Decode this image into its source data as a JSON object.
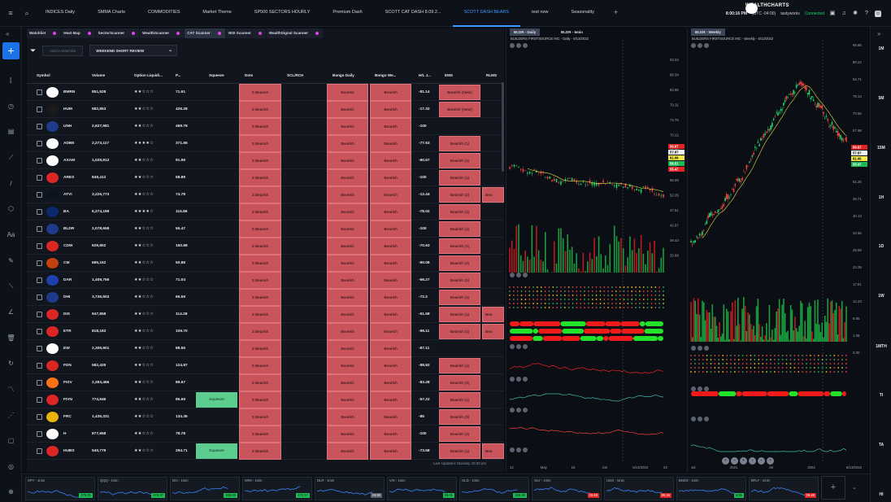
{
  "top_tabs": [
    "INDICES Daily",
    "SMMA Charts",
    "COMMODITIES",
    "Market Theme",
    "SP500 SECTORS HOURLY",
    "Premium Dash",
    "SCOTT CAT DASH 8.09.2...",
    "SCOTT DASH BEARS",
    "test now",
    "Seasonality"
  ],
  "active_tab_index": 7,
  "topbar": {
    "time": "8:00:16 PM",
    "timezone": "(UTC -04:00)",
    "broker": "tastyworks",
    "connection": "Connected",
    "brand": "WEALTHCHARTS"
  },
  "scanner": {
    "tabs": [
      "Watchlist",
      "Heat Map",
      "SectorScanner",
      "WealthScanner",
      "CAT Scanner",
      "WSI Scanner",
      "WealthSignal Scanner"
    ],
    "active_tab_index": 4,
    "add_to_watchlist_label": "Add to Watchlist",
    "selected_scan": "WEEKEND SHORT REVIEW",
    "columns": [
      "Symbol",
      "Volume",
      "Option Liquidi...",
      "P...",
      "Squeeze",
      "Dots",
      "SCL/RCH",
      "Bongo Daily",
      "Bongo We...",
      "H/L J...",
      "EMS",
      "RLMS"
    ],
    "rows": [
      {
        "symbol": "BMRN",
        "volume": "851,528",
        "stars": "★★☆☆☆",
        "price": "71.91",
        "squeeze": "",
        "dots": "3 Bearish",
        "bongo_d": "Bearish",
        "bongo_w": "Bearish",
        "hl": "-81.14",
        "ems": "Bearish (New)",
        "rlms": ""
      },
      {
        "symbol": "HUM",
        "volume": "582,853",
        "stars": "★★☆☆☆",
        "price": "426.28",
        "squeeze": "",
        "dots": "3 Bearish",
        "bongo_d": "Bearish",
        "bongo_w": "Bearish",
        "hl": "-17.32",
        "ems": "Bearish (New)",
        "rlms": ""
      },
      {
        "symbol": "UNH",
        "volume": "2,627,981",
        "stars": "★★☆☆☆",
        "price": "469.78",
        "squeeze": "",
        "dots": "3 Bearish",
        "bongo_d": "Bearish",
        "bongo_w": "Bearish",
        "hl": "-100",
        "ems": "",
        "rlms": ""
      },
      {
        "symbol": "ADBE",
        "volume": "2,273,117",
        "stars": "★★★★☆",
        "price": "371.65",
        "squeeze": "",
        "dots": "3 Bearish",
        "bongo_d": "Bearish",
        "bongo_w": "Bearish",
        "hl": "-77.53",
        "ems": "Bearish (1)",
        "rlms": ""
      },
      {
        "symbol": "AXAM",
        "volume": "1,029,912",
        "stars": "★★☆☆☆",
        "price": "91.96",
        "squeeze": "",
        "dots": "3 Bearish",
        "bongo_d": "Bearish",
        "bongo_w": "Bearish",
        "hl": "-60.57",
        "ems": "Bearish (1)",
        "rlms": ""
      },
      {
        "symbol": "ARES",
        "volume": "849,412",
        "stars": "★★☆☆☆",
        "price": "58.89",
        "squeeze": "",
        "dots": "3 Bearish",
        "bongo_d": "Bearish",
        "bongo_w": "Bearish",
        "hl": "-100",
        "ems": "Bearish (1)",
        "rlms": ""
      },
      {
        "symbol": "ATVI",
        "volume": "3,226,773",
        "stars": "★★☆☆☆",
        "price": "74.78",
        "squeeze": "",
        "dots": "3 Bearish",
        "bongo_d": "Bearish",
        "bongo_w": "Bearish",
        "hl": "-12.44",
        "ems": "Bearish (2)",
        "rlms": "Bea"
      },
      {
        "symbol": "BA",
        "volume": "6,274,199",
        "stars": "★★★★☆",
        "price": "115.86",
        "squeeze": "",
        "dots": "3 Bearish",
        "bongo_d": "Bearish",
        "bongo_w": "Bearish",
        "hl": "-78.02",
        "ems": "Bearish (1)",
        "rlms": ""
      },
      {
        "symbol": "BLDR",
        "volume": "2,078,658",
        "stars": "★★☆☆☆",
        "price": "55.47",
        "squeeze": "",
        "dots": "3 Bearish",
        "bongo_d": "Bearish",
        "bongo_w": "Bearish",
        "hl": "-100",
        "ems": "Bearish (1)",
        "rlms": ""
      },
      {
        "symbol": "CDW",
        "volume": "629,802",
        "stars": "★★☆☆☆",
        "price": "160.88",
        "squeeze": "",
        "dots": "3 Bearish",
        "bongo_d": "Bearish",
        "bongo_w": "Bearish",
        "hl": "-70.63",
        "ems": "Bearish (1)",
        "rlms": ""
      },
      {
        "symbol": "CM",
        "volume": "685,152",
        "stars": "★★☆☆☆",
        "price": "50.88",
        "squeeze": "",
        "dots": "3 Bearish",
        "bongo_d": "Bearish",
        "bongo_w": "Bearish",
        "hl": "-90.08",
        "ems": "Bearish (2)",
        "rlms": ""
      },
      {
        "symbol": "DAR",
        "volume": "1,409,755",
        "stars": "★★☆☆☆",
        "price": "71.04",
        "squeeze": "",
        "dots": "3 Bearish",
        "bongo_d": "Bearish",
        "bongo_w": "Bearish",
        "hl": "-66.27",
        "ems": "Bearish (2)",
        "rlms": ""
      },
      {
        "symbol": "DHI",
        "volume": "3,736,503",
        "stars": "★★☆☆☆",
        "price": "66.59",
        "squeeze": "",
        "dots": "3 Bearish",
        "bongo_d": "Bearish",
        "bongo_w": "Bearish",
        "hl": "-72.2",
        "ems": "Bearish (1)",
        "rlms": ""
      },
      {
        "symbol": "DIS",
        "volume": "947,858",
        "stars": "★★☆☆☆",
        "price": "114.28",
        "squeeze": "",
        "dots": "3 Bearish",
        "bongo_d": "Bearish",
        "bongo_w": "Bearish",
        "hl": "-51.58",
        "ems": "Bearish (1)",
        "rlms": "Bea"
      },
      {
        "symbol": "ETR",
        "volume": "818,183",
        "stars": "★★☆☆☆",
        "price": "109.70",
        "squeeze": "",
        "dots": "3 Bearish",
        "bongo_d": "Bearish",
        "bongo_w": "Bearish",
        "hl": "-98.11",
        "ems": "Bearish (1)",
        "rlms": "Bea"
      },
      {
        "symbol": "EW",
        "volume": "2,306,901",
        "stars": "★★☆☆☆",
        "price": "88.55",
        "squeeze": "",
        "dots": "3 Bearish",
        "bongo_d": "Bearish",
        "bongo_w": "Bearish",
        "hl": "-87.11",
        "ems": "",
        "rlms": ""
      },
      {
        "symbol": "FDN",
        "volume": "582,429",
        "stars": "★★☆☆☆",
        "price": "124.87",
        "squeeze": "",
        "dots": "3 Bearish",
        "bongo_d": "Bearish",
        "bongo_w": "Bearish",
        "hl": "-88.92",
        "ems": "Bearish (1)",
        "rlms": ""
      },
      {
        "symbol": "FISV",
        "volume": "2,283,466",
        "stars": "★★☆☆☆",
        "price": "89.67",
        "squeeze": "",
        "dots": "3 Bearish",
        "bongo_d": "Bearish",
        "bongo_w": "Bearish",
        "hl": "-83.28",
        "ems": "Bearish (2)",
        "rlms": ""
      },
      {
        "symbol": "FIVN",
        "volume": "774,946",
        "stars": "★★☆☆☆",
        "price": "85.69",
        "squeeze": "Squeeze",
        "dots": "3 Bearish",
        "bongo_d": "Bearish",
        "bongo_w": "Bearish",
        "hl": "-57.22",
        "ems": "Bearish (1)",
        "rlms": ""
      },
      {
        "symbol": "FRC",
        "volume": "1,435,331",
        "stars": "★★☆☆☆",
        "price": "134.36",
        "squeeze": "",
        "dots": "3 Bearish",
        "bongo_d": "Bearish",
        "bongo_w": "Bearish",
        "hl": "-85",
        "ems": "Bearish (3)",
        "rlms": ""
      },
      {
        "symbol": "H",
        "volume": "877,658",
        "stars": "★★☆☆☆",
        "price": "78.78",
        "squeeze": "",
        "dots": "3 Bearish",
        "bongo_d": "Bearish",
        "bongo_w": "Bearish",
        "hl": "-100",
        "ems": "Bearish (2)",
        "rlms": ""
      },
      {
        "symbol": "HUBS",
        "volume": "540,779",
        "stars": "★★☆☆☆",
        "price": "294.71",
        "squeeze": "Squeeze",
        "dots": "3 Bearish",
        "bongo_d": "Bearish",
        "bongo_w": "Bearish",
        "hl": "-73.58",
        "ems": "Bearish (1)",
        "rlms": "Bea"
      }
    ],
    "last_updated": "Last Updated: Monday 20:00 pm"
  },
  "chart_left": {
    "tabs": [
      "BLDR - Daily",
      "BLDR - 5min"
    ],
    "title": "BUILDERS FIRSTSOURCE INC - Daily - 6/13/2022",
    "axis": [
      "93.04",
      "88.34",
      "83.85",
      "79.31",
      "74.76",
      "70.22",
      "65.68",
      "61.14",
      "56.59",
      "52.05",
      "47.51",
      "42.97",
      "38.43",
      "33.88"
    ],
    "tags": [
      "56.67",
      "57.87",
      "61.06",
      "56.51",
      "55.47"
    ],
    "x_labels": [
      "12",
      "May",
      "16",
      "Jun",
      "6/13/2022",
      "23"
    ],
    "ind_axis": [
      "8.000",
      "4.000",
      "0.000",
      "-4.000",
      "-8.000",
      "0.100",
      "-0.050",
      "-0.100",
      "3.00",
      "2.00",
      "1.00",
      "0.50",
      "0.00",
      "-100.00",
      "-150.00",
      "0.14",
      "0.00",
      "-0.05",
      "-0.10",
      "140.00M",
      "120.00M",
      "100.00M",
      "80.00M",
      "60.00M",
      "40.00M",
      "20.00M",
      "0.000M"
    ],
    "ind_tags": [
      "0.46",
      "13.23",
      "-100.00",
      "0.14",
      "112.00M"
    ]
  },
  "chart_right": {
    "tabs": [
      "BLDR - Weekly"
    ],
    "title": "BUILDERS FIRSTSOURCE INC - Weekly - 6/13/2022",
    "axis": [
      "95.86",
      "90.22",
      "84.71",
      "79.13",
      "73.56",
      "67.98",
      "62.40",
      "56.28",
      "51.26",
      "45.71",
      "40.13",
      "34.55",
      "28.98",
      "23.39",
      "17.81",
      "12.23",
      "6.65",
      "1.08",
      "0.00"
    ],
    "tags": [
      "56.67",
      "57.87",
      "61.06",
      "55.47"
    ],
    "x_labels": [
      "Jul",
      "2021",
      "Jul",
      "2022",
      "6/13/2022"
    ],
    "ind_axis": [
      "1.60",
      "1.20",
      "0.80",
      "0.40",
      "0.00",
      "0.14",
      "0.06",
      "0.00"
    ],
    "ind_tags": [
      "0.14",
      "0.06",
      "0.12",
      "0.04"
    ]
  },
  "timeframes": [
    "1M",
    "5M",
    "15M",
    "1H",
    "1D",
    "1W",
    "1MTH",
    "TI",
    "TA",
    "HI"
  ],
  "mini_charts": [
    {
      "label": "SPY - 1min",
      "price": "375.01",
      "color": "g"
    },
    {
      "label": "QQQ - 1min",
      "price": "275.47",
      "color": "g"
    },
    {
      "label": "DIA - 1min",
      "price": "335.63",
      "color": "g"
    },
    {
      "label": "IWM - 1min",
      "price": "170.17",
      "color": "g"
    },
    {
      "label": "DLR - 1min",
      "price": "24.50",
      "color": "gr"
    },
    {
      "label": "VIX - 1min",
      "price": "25.01",
      "color": "g"
    },
    {
      "label": "GLD - 1min",
      "price": "169.93",
      "color": "g"
    },
    {
      "label": "SLV - 1min",
      "price": "19.53",
      "color": "r"
    },
    {
      "label": "USO - 1min",
      "price": "80.34",
      "color": "r"
    },
    {
      "label": "BNDX - 1min",
      "price": "6.55",
      "color": "g"
    },
    {
      "label": "BFLY - 1min",
      "price": "29.49",
      "color": "r"
    }
  ]
}
